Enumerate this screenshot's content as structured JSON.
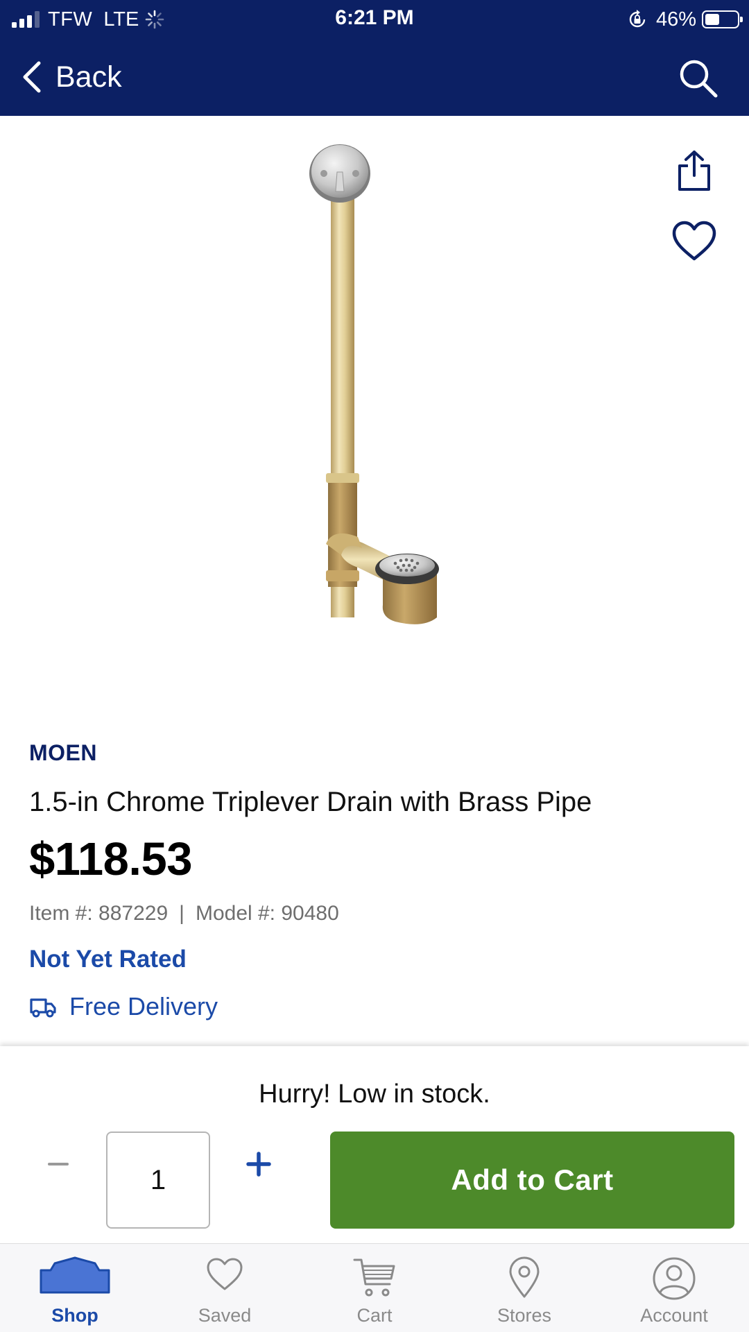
{
  "status_bar": {
    "carrier": "TFW",
    "network": "LTE",
    "time": "6:21 PM",
    "battery_percent": "46%",
    "battery_level": 0.46,
    "signal_bars": 3
  },
  "nav": {
    "back_label": "Back"
  },
  "product": {
    "brand": "MOEN",
    "title": "1.5-in Chrome Triplever Drain with Brass Pipe",
    "price": "$118.53",
    "item_number": "Item #: 887229",
    "separator": "|",
    "model_number": "Model #: 90480",
    "rating": "Not Yet Rated",
    "delivery": "Free Delivery"
  },
  "cart": {
    "stock_message": "Hurry! Low in stock.",
    "quantity": "1",
    "add_to_cart_label": "Add to Cart"
  },
  "tabs": [
    {
      "label": "Shop",
      "icon": "home-icon",
      "active": true
    },
    {
      "label": "Saved",
      "icon": "heart-icon",
      "active": false
    },
    {
      "label": "Cart",
      "icon": "cart-icon",
      "active": false
    },
    {
      "label": "Stores",
      "icon": "location-pin-icon",
      "active": false
    },
    {
      "label": "Account",
      "icon": "user-icon",
      "active": false
    }
  ],
  "colors": {
    "header": "#0c2064",
    "link_blue": "#1b4aa8",
    "add_to_cart_green": "#4d8a2a",
    "tab_inactive": "#8a8a8a"
  }
}
